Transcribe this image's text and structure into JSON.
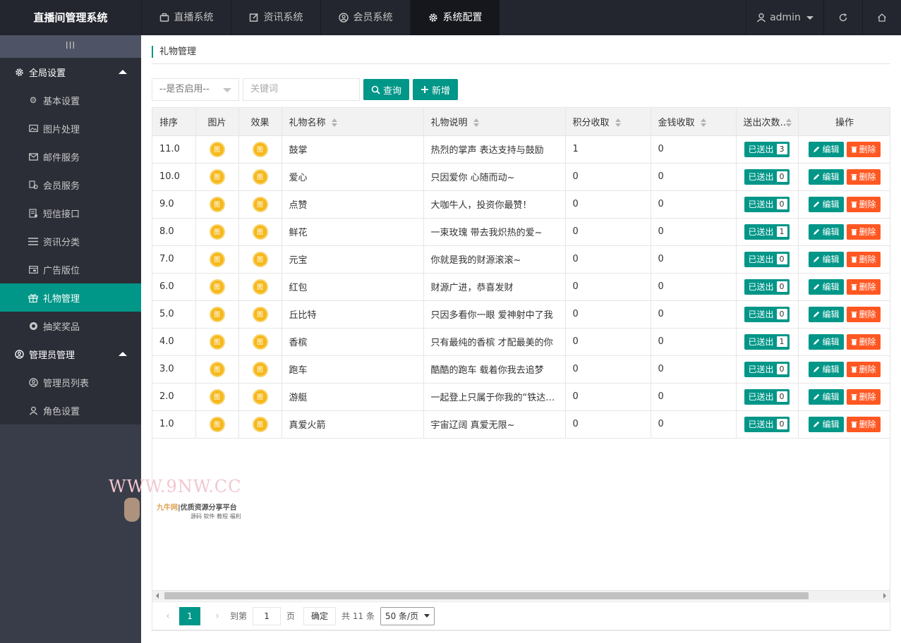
{
  "brand": "直播间管理系统",
  "topnav": [
    {
      "label": "直播系统",
      "icon": "briefcase-icon"
    },
    {
      "label": "资讯系统",
      "icon": "edit-icon"
    },
    {
      "label": "会员系统",
      "icon": "user-circle-icon"
    },
    {
      "label": "系统配置",
      "icon": "gear-icon",
      "active": true
    }
  ],
  "user": {
    "name": "admin"
  },
  "sidebar": {
    "toggle": "III",
    "groups": [
      {
        "label": "全局设置",
        "items": [
          {
            "label": "基本设置",
            "icon": "gear-icon"
          },
          {
            "label": "图片处理",
            "icon": "image-icon"
          },
          {
            "label": "邮件服务",
            "icon": "mail-icon"
          },
          {
            "label": "会员服务",
            "icon": "member-icon"
          },
          {
            "label": "短信接口",
            "icon": "sms-icon"
          },
          {
            "label": "资讯分类",
            "icon": "list-icon"
          },
          {
            "label": "广告版位",
            "icon": "ad-icon"
          },
          {
            "label": "礼物管理",
            "icon": "gift-icon",
            "active": true
          },
          {
            "label": "抽奖奖品",
            "icon": "prize-icon"
          }
        ]
      },
      {
        "label": "管理员管理",
        "items": [
          {
            "label": "管理员列表",
            "icon": "user-circle-icon"
          },
          {
            "label": "角色设置",
            "icon": "user-icon"
          }
        ]
      }
    ]
  },
  "page": {
    "breadcrumb": "礼物管理",
    "filter_select": "--是否启用--",
    "keyword_placeholder": "关键词",
    "search_label": "查询",
    "add_label": "新增"
  },
  "table": {
    "headers": [
      "排序",
      "图片",
      "效果",
      "礼物名称",
      "礼物说明",
      "积分收取",
      "金钱收取",
      "送出次数",
      "操作"
    ],
    "pic_glyph": "图",
    "sent_label": "已送出",
    "edit_label": "编辑",
    "delete_label": "删除",
    "rows": [
      {
        "order": "11.0",
        "name": "鼓掌",
        "desc": "热烈的掌声 表达支持与鼓励",
        "points": "1",
        "money": "0",
        "sent": "3"
      },
      {
        "order": "10.0",
        "name": "爱心",
        "desc": "只因爱你 心随而动~",
        "points": "0",
        "money": "0",
        "sent": "0"
      },
      {
        "order": "9.0",
        "name": "点赞",
        "desc": "大咖牛人，投资你最赞！",
        "points": "0",
        "money": "0",
        "sent": "0"
      },
      {
        "order": "8.0",
        "name": "鲜花",
        "desc": "一束玫瑰 带去我炽热的爱~",
        "points": "0",
        "money": "0",
        "sent": "1"
      },
      {
        "order": "7.0",
        "name": "元宝",
        "desc": "你就是我的财源滚滚~",
        "points": "0",
        "money": "0",
        "sent": "0"
      },
      {
        "order": "6.0",
        "name": "红包",
        "desc": "财源广进，恭喜发财",
        "points": "0",
        "money": "0",
        "sent": "0"
      },
      {
        "order": "5.0",
        "name": "丘比特",
        "desc": "只因多看你一眼 爱神射中了我",
        "points": "0",
        "money": "0",
        "sent": "0"
      },
      {
        "order": "4.0",
        "name": "香槟",
        "desc": "只有最纯的香槟 才配最美的你",
        "points": "0",
        "money": "0",
        "sent": "1"
      },
      {
        "order": "3.0",
        "name": "跑车",
        "desc": "酷酷的跑车 载着你我去追梦",
        "points": "0",
        "money": "0",
        "sent": "0"
      },
      {
        "order": "2.0",
        "name": "游艇",
        "desc": "一起登上只属于你我的“铁达尼号”",
        "points": "0",
        "money": "0",
        "sent": "0"
      },
      {
        "order": "1.0",
        "name": "真爱火箭",
        "desc": "宇宙辽阔 真爱无限~",
        "points": "0",
        "money": "0",
        "sent": "0"
      }
    ]
  },
  "pager": {
    "current": "1",
    "goto_label": "到第",
    "goto_value": "1",
    "page_unit": "页",
    "confirm": "确定",
    "total": "共 11 条",
    "limit": "50 条/页"
  },
  "watermark": {
    "url": "WWW.9NW.CC",
    "line1_a": "九牛网",
    "line1_b": "|优质资源分享平台",
    "line2": "源码 软件 教程 福利"
  },
  "colors": {
    "accent": "#009688",
    "danger": "#ff5722",
    "sidebar": "#393d49",
    "header": "#23262e"
  }
}
